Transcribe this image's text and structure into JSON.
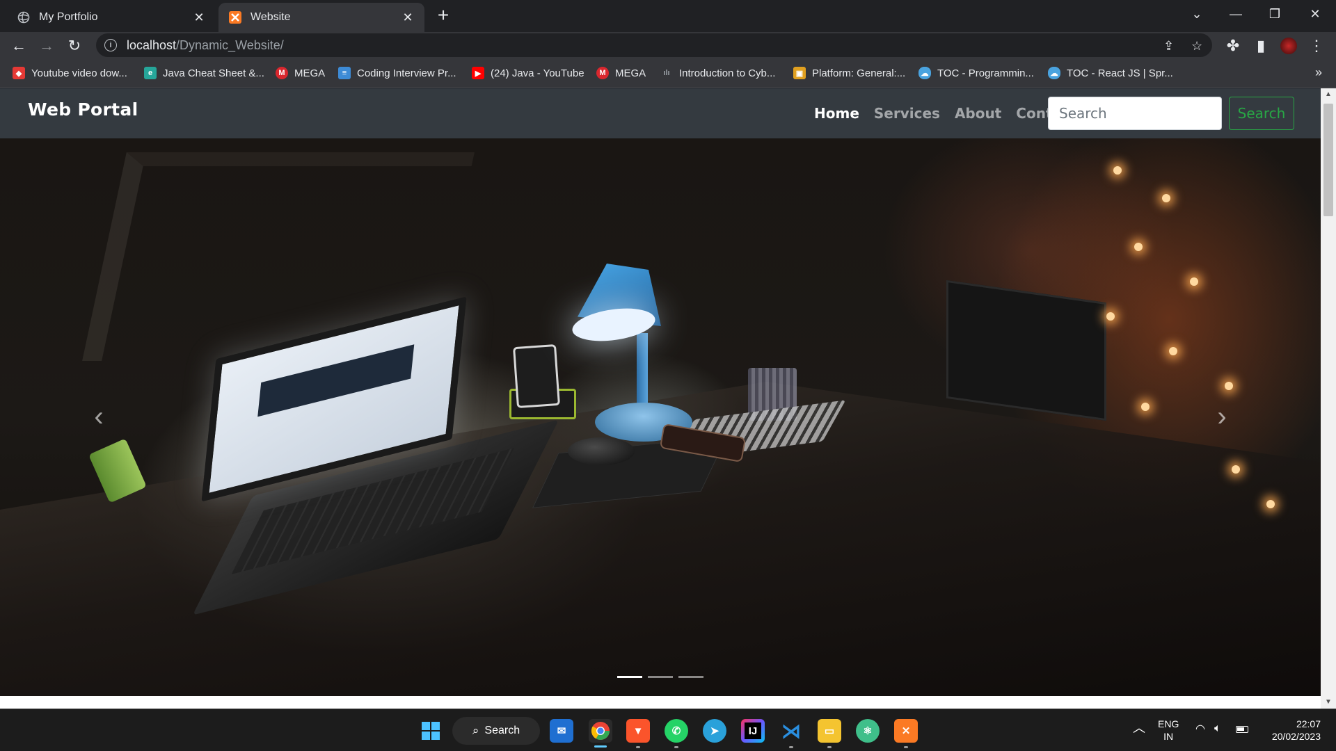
{
  "browser": {
    "tabs": [
      {
        "title": "My Portfolio",
        "icon": "globe-icon",
        "active": false
      },
      {
        "title": "Website",
        "icon": "xampp-icon",
        "active": true
      }
    ],
    "new_tab_label": "+",
    "url_host": "localhost",
    "url_path": "/Dynamic_Website/",
    "bookmarks": [
      {
        "label": "Youtube video dow...",
        "icon": "y2mate-icon",
        "color": "#e53935"
      },
      {
        "label": "Java Cheat Sheet &...",
        "icon": "edureka-icon",
        "color": "#26a69a"
      },
      {
        "label": "MEGA",
        "icon": "mega-icon",
        "color": "#d9272e"
      },
      {
        "label": "Coding Interview Pr...",
        "icon": "book-icon",
        "color": "#3d8bd6"
      },
      {
        "label": "(24) Java - YouTube",
        "icon": "youtube-icon",
        "color": "#ff0000"
      },
      {
        "label": "MEGA",
        "icon": "mega-icon",
        "color": "#d9272e"
      },
      {
        "label": "Introduction to Cyb...",
        "icon": "cisco-icon",
        "color": "#5f6368"
      },
      {
        "label": "Platform: General:...",
        "icon": "package-icon",
        "color": "#e0a020"
      },
      {
        "label": "TOC - Programmin...",
        "icon": "cloud-icon",
        "color": "#4aa3df"
      },
      {
        "label": "TOC - React JS | Spr...",
        "icon": "cloud-icon",
        "color": "#4aa3df"
      }
    ]
  },
  "page": {
    "brand": "Web Portal",
    "nav": [
      {
        "label": "Home",
        "active": true
      },
      {
        "label": "Services",
        "active": false
      },
      {
        "label": "About",
        "active": false
      },
      {
        "label": "Contact",
        "active": false
      }
    ],
    "search_placeholder": "Search",
    "search_button": "Search",
    "carousel": {
      "prev_label": "‹",
      "next_label": "›",
      "slide_count": 3,
      "active_slide": 1
    }
  },
  "taskbar": {
    "search_label": "Search",
    "apps": [
      {
        "name": "mail-icon",
        "color": "#1f6fd1"
      },
      {
        "name": "chrome-icon",
        "color": "#ea4335"
      },
      {
        "name": "brave-icon",
        "color": "#fb542b"
      },
      {
        "name": "whatsapp-icon",
        "color": "#25d366"
      },
      {
        "name": "telegram-icon",
        "color": "#2aa1da"
      },
      {
        "name": "intellij-icon",
        "color": "#6b57ff"
      },
      {
        "name": "vscode-icon",
        "color": "#2a8fe0"
      },
      {
        "name": "file-explorer-icon",
        "color": "#f4c430"
      },
      {
        "name": "atom-icon",
        "color": "#3fbf8a"
      },
      {
        "name": "xampp-icon",
        "color": "#fb7a24"
      }
    ],
    "lang_line1": "ENG",
    "lang_line2": "IN",
    "time": "22:07",
    "date": "20/02/2023"
  }
}
